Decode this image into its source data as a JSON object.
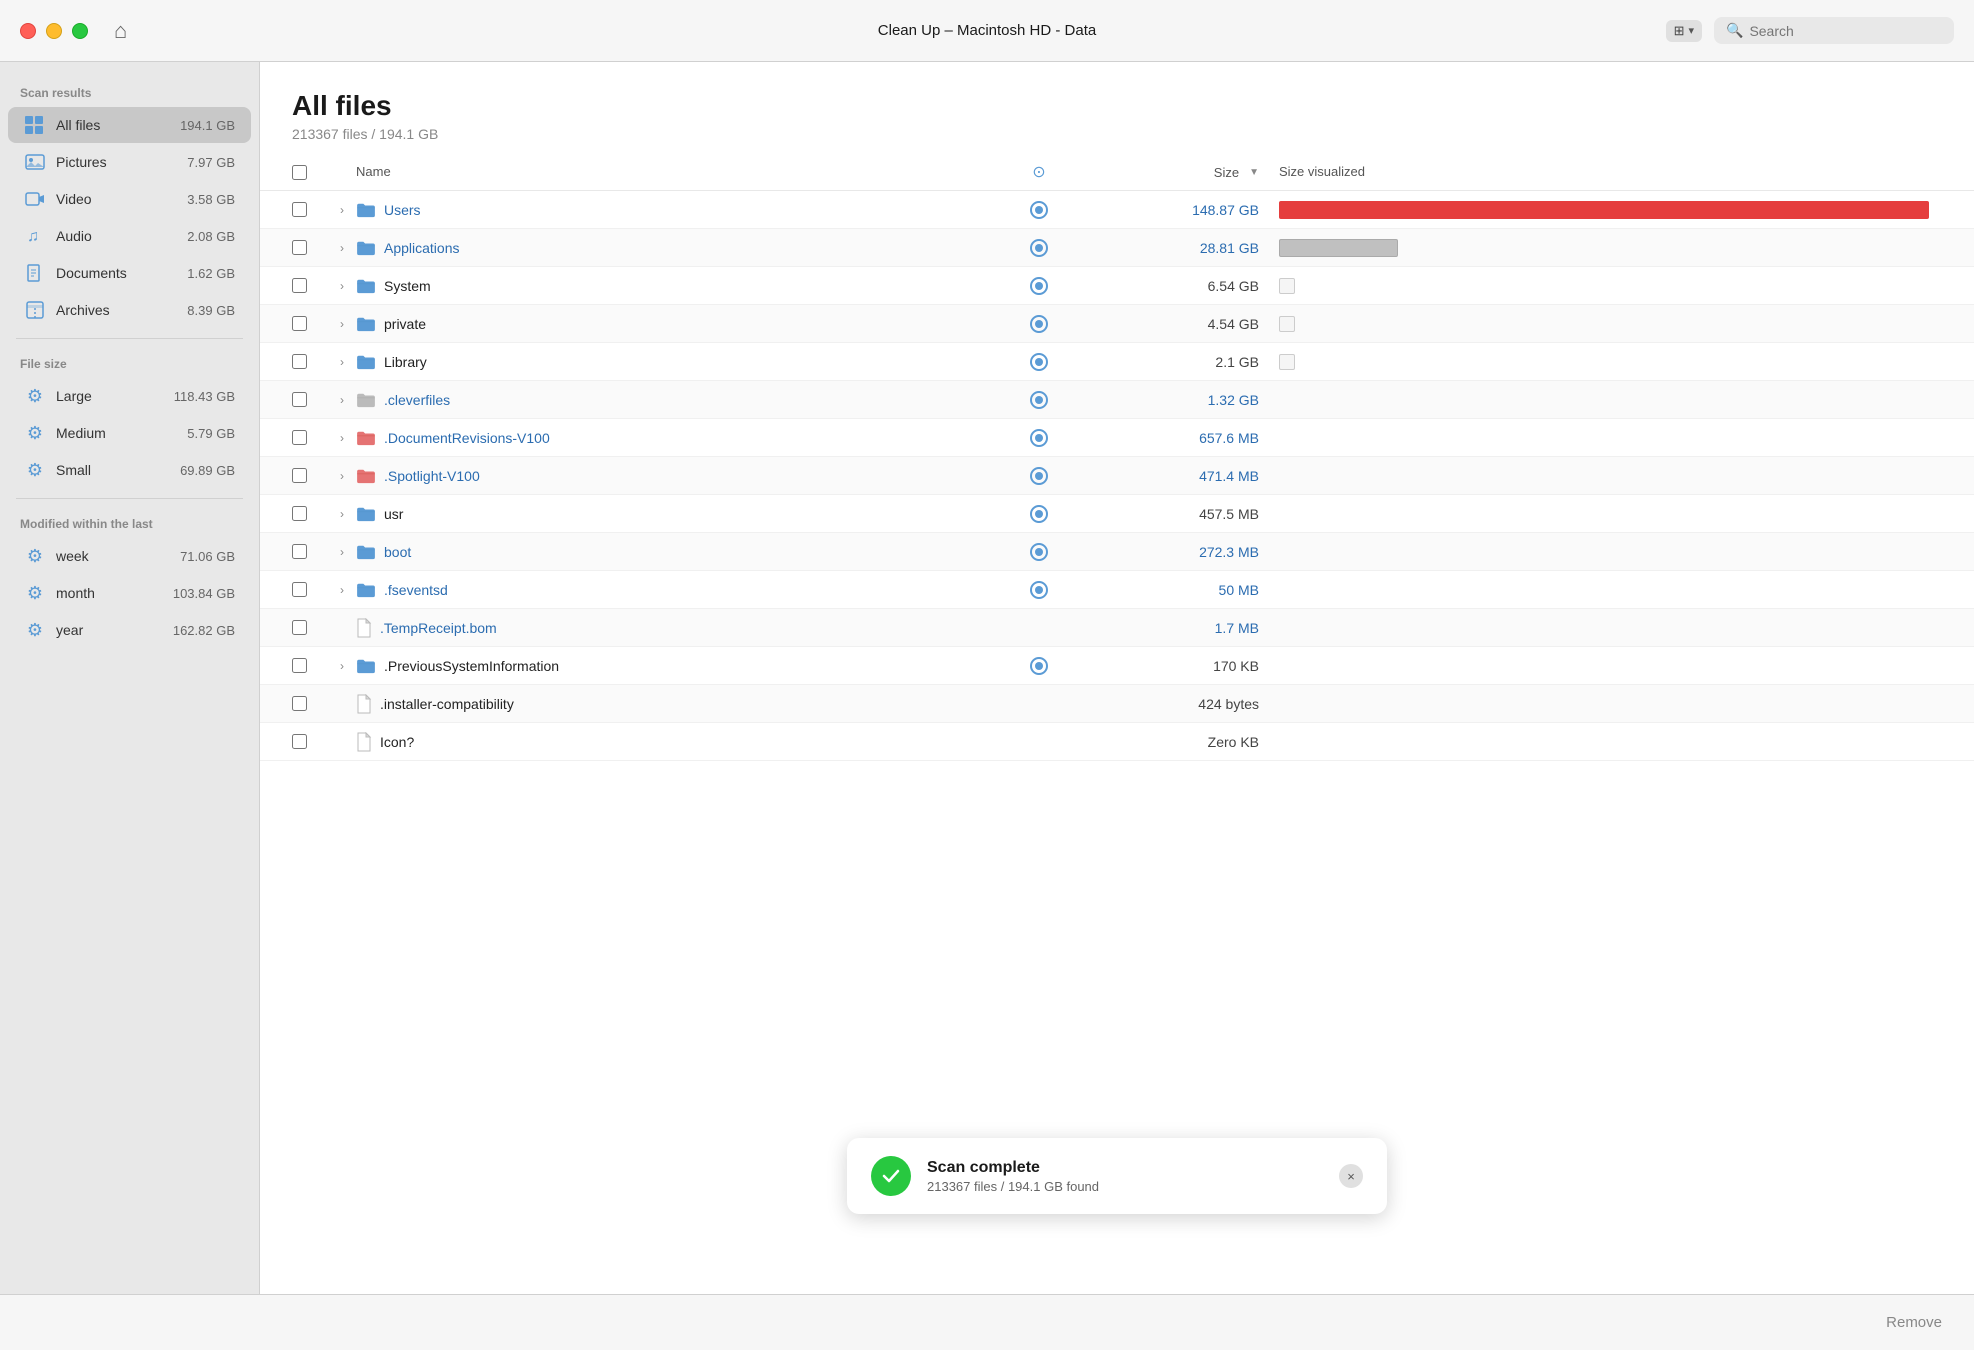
{
  "titlebar": {
    "title": "Clean Up – Macintosh HD - Data",
    "home_icon": "⌂",
    "view_label": "⊞",
    "search_placeholder": "Search"
  },
  "sidebar": {
    "scan_results_label": "Scan results",
    "scan_items": [
      {
        "id": "all-files",
        "icon": "grid",
        "label": "All files",
        "size": "194.1 GB",
        "active": true
      },
      {
        "id": "pictures",
        "icon": "picture",
        "label": "Pictures",
        "size": "7.97 GB",
        "active": false
      },
      {
        "id": "video",
        "icon": "video",
        "label": "Video",
        "size": "3.58 GB",
        "active": false
      },
      {
        "id": "audio",
        "icon": "audio",
        "label": "Audio",
        "size": "2.08 GB",
        "active": false
      },
      {
        "id": "documents",
        "icon": "document",
        "label": "Documents",
        "size": "1.62 GB",
        "active": false
      },
      {
        "id": "archives",
        "icon": "archive",
        "label": "Archives",
        "size": "8.39 GB",
        "active": false
      }
    ],
    "file_size_label": "File size",
    "file_size_items": [
      {
        "id": "large",
        "label": "Large",
        "size": "118.43 GB"
      },
      {
        "id": "medium",
        "label": "Medium",
        "size": "5.79 GB"
      },
      {
        "id": "small",
        "label": "Small",
        "size": "69.89 GB"
      }
    ],
    "modified_label": "Modified within the last",
    "modified_items": [
      {
        "id": "week",
        "label": "week",
        "size": "71.06 GB"
      },
      {
        "id": "month",
        "label": "month",
        "size": "103.84 GB"
      },
      {
        "id": "year",
        "label": "year",
        "size": "162.82 GB"
      }
    ]
  },
  "content": {
    "page_title": "All files",
    "page_subtitle": "213367 files / 194.1 GB",
    "table": {
      "col_name": "Name",
      "col_size": "Size",
      "col_size_viz": "Size visualized",
      "rows": [
        {
          "id": "users",
          "name": "Users",
          "size": "148.87 GB",
          "size_color": "blue",
          "name_color": "blue",
          "has_expand": true,
          "has_folder": true,
          "has_pin": true,
          "folder_color": "blue",
          "viz_type": "bar-red",
          "viz_width": 98
        },
        {
          "id": "applications",
          "name": "Applications",
          "size": "28.81 GB",
          "size_color": "blue",
          "name_color": "blue",
          "has_expand": true,
          "has_folder": true,
          "has_pin": true,
          "folder_color": "blue",
          "viz_type": "bar-gray",
          "viz_width": 18
        },
        {
          "id": "system",
          "name": "System",
          "size": "6.54 GB",
          "size_color": "normal",
          "name_color": "normal",
          "has_expand": true,
          "has_folder": true,
          "has_pin": true,
          "folder_color": "blue",
          "viz_type": "mini",
          "viz_width": 0
        },
        {
          "id": "private",
          "name": "private",
          "size": "4.54 GB",
          "size_color": "normal",
          "name_color": "normal",
          "has_expand": true,
          "has_folder": true,
          "has_pin": true,
          "folder_color": "blue",
          "viz_type": "mini",
          "viz_width": 0
        },
        {
          "id": "library",
          "name": "Library",
          "size": "2.1 GB",
          "size_color": "normal",
          "name_color": "normal",
          "has_expand": true,
          "has_folder": true,
          "has_pin": true,
          "folder_color": "blue",
          "viz_type": "mini",
          "viz_width": 0
        },
        {
          "id": "cleverfiles",
          "name": ".cleverfiles",
          "size": "1.32 GB",
          "size_color": "blue",
          "name_color": "blue",
          "has_expand": true,
          "has_folder": true,
          "has_pin": true,
          "folder_color": "gray",
          "viz_type": "none",
          "viz_width": 0
        },
        {
          "id": "doc-revisions",
          "name": ".DocumentRevisions-V100",
          "size": "657.6 MB",
          "size_color": "blue",
          "name_color": "blue",
          "has_expand": true,
          "has_folder": true,
          "has_pin": true,
          "folder_color": "red",
          "viz_type": "none",
          "viz_width": 0
        },
        {
          "id": "spotlight",
          "name": ".Spotlight-V100",
          "size": "471.4 MB",
          "size_color": "blue",
          "name_color": "blue",
          "has_expand": true,
          "has_folder": true,
          "has_pin": true,
          "folder_color": "red",
          "viz_type": "none",
          "viz_width": 0
        },
        {
          "id": "usr",
          "name": "usr",
          "size": "457.5 MB",
          "size_color": "normal",
          "name_color": "normal",
          "has_expand": true,
          "has_folder": true,
          "has_pin": true,
          "folder_color": "blue",
          "viz_type": "none",
          "viz_width": 0
        },
        {
          "id": "boot",
          "name": "boot",
          "size": "272.3 MB",
          "size_color": "blue",
          "name_color": "blue",
          "has_expand": true,
          "has_folder": true,
          "has_pin": true,
          "folder_color": "blue",
          "viz_type": "none",
          "viz_width": 0
        },
        {
          "id": "fseventsd",
          "name": ".fseventsd",
          "size": "50 MB",
          "size_color": "blue",
          "name_color": "blue",
          "has_expand": true,
          "has_folder": true,
          "has_pin": true,
          "folder_color": "blue",
          "viz_type": "none",
          "viz_width": 0
        },
        {
          "id": "tempreceipt",
          "name": ".TempReceipt.bom",
          "size": "1.7 MB",
          "size_color": "blue",
          "name_color": "blue",
          "has_expand": false,
          "has_folder": false,
          "has_pin": false,
          "folder_color": "",
          "viz_type": "none",
          "viz_width": 0
        },
        {
          "id": "prev-sys",
          "name": ".PreviousSystemInformation",
          "size": "170 KB",
          "size_color": "normal",
          "name_color": "normal",
          "has_expand": true,
          "has_folder": true,
          "has_pin": true,
          "folder_color": "blue",
          "viz_type": "none",
          "viz_width": 0
        },
        {
          "id": "installer-compat",
          "name": ".installer-compatibility",
          "size": "424 bytes",
          "size_color": "normal",
          "name_color": "normal",
          "has_expand": false,
          "has_folder": false,
          "has_pin": false,
          "folder_color": "",
          "viz_type": "none",
          "viz_width": 0
        },
        {
          "id": "icon",
          "name": "Icon?",
          "size": "Zero KB",
          "size_color": "normal",
          "name_color": "normal",
          "has_expand": false,
          "has_folder": false,
          "has_pin": false,
          "folder_color": "",
          "viz_type": "none",
          "viz_width": 0
        }
      ]
    }
  },
  "notification": {
    "title": "Scan complete",
    "subtitle": "213367 files / 194.1 GB found",
    "close_label": "×"
  },
  "bottom_toolbar": {
    "remove_label": "Remove"
  }
}
